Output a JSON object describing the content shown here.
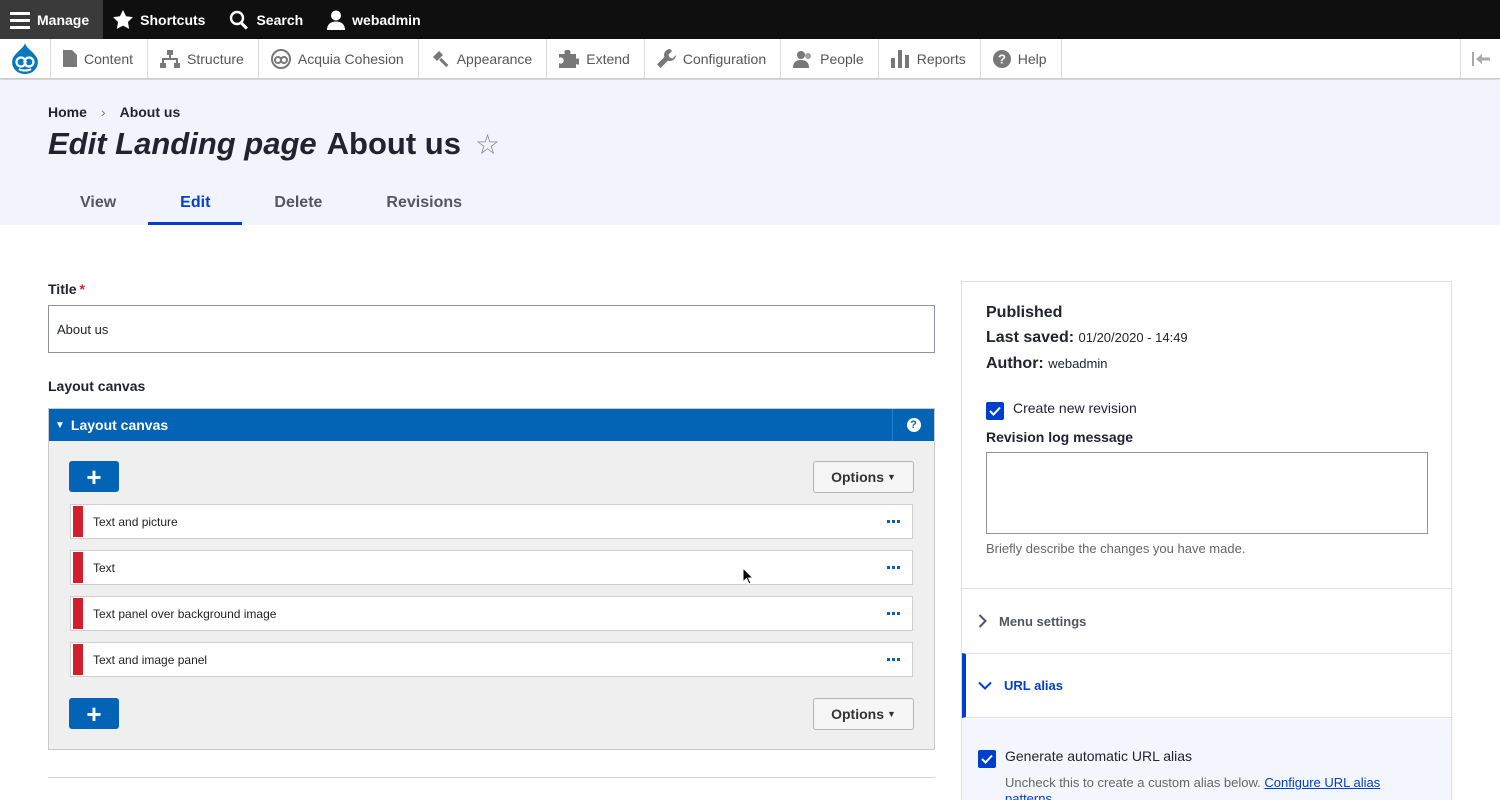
{
  "toolbar": {
    "manage": "Manage",
    "shortcuts": "Shortcuts",
    "search": "Search",
    "user": "webadmin"
  },
  "tray": {
    "items": [
      "Content",
      "Structure",
      "Acquia Cohesion",
      "Appearance",
      "Extend",
      "Configuration",
      "People",
      "Reports",
      "Help"
    ]
  },
  "breadcrumb": {
    "home": "Home",
    "sep": "›",
    "current": "About us"
  },
  "page": {
    "title_em": "Edit Landing page",
    "title_rest": "About us",
    "star": "☆"
  },
  "tabs": [
    "View",
    "Edit",
    "Delete",
    "Revisions"
  ],
  "form": {
    "title_label": "Title",
    "required_mark": "*",
    "title_value": "About us",
    "canvas_label": "Layout canvas",
    "canvas_header": "Layout canvas",
    "help": "?",
    "add": "+",
    "options": "Options",
    "items": [
      "Text and picture",
      "Text",
      "Text panel over background image",
      "Text and image panel"
    ]
  },
  "sidebar": {
    "status": "Published",
    "last_saved_label": "Last saved:",
    "last_saved_value": "01/20/2020 - 14:49",
    "author_label": "Author:",
    "author_value": "webadmin",
    "create_revision": "Create new revision",
    "revision_log_label": "Revision log message",
    "revision_log_desc": "Briefly describe the changes you have made.",
    "menu_settings": "Menu settings",
    "url_alias": "URL alias",
    "generate_alias": "Generate automatic URL alias",
    "alias_desc": "Uncheck this to create a custom alias below.",
    "alias_link": "Configure URL alias patterns."
  },
  "colors": {
    "accent": "#003ecc",
    "canvas_header": "#0364b5",
    "item_marker": "#d21f2e",
    "header_bg": "#f2f4fd"
  }
}
